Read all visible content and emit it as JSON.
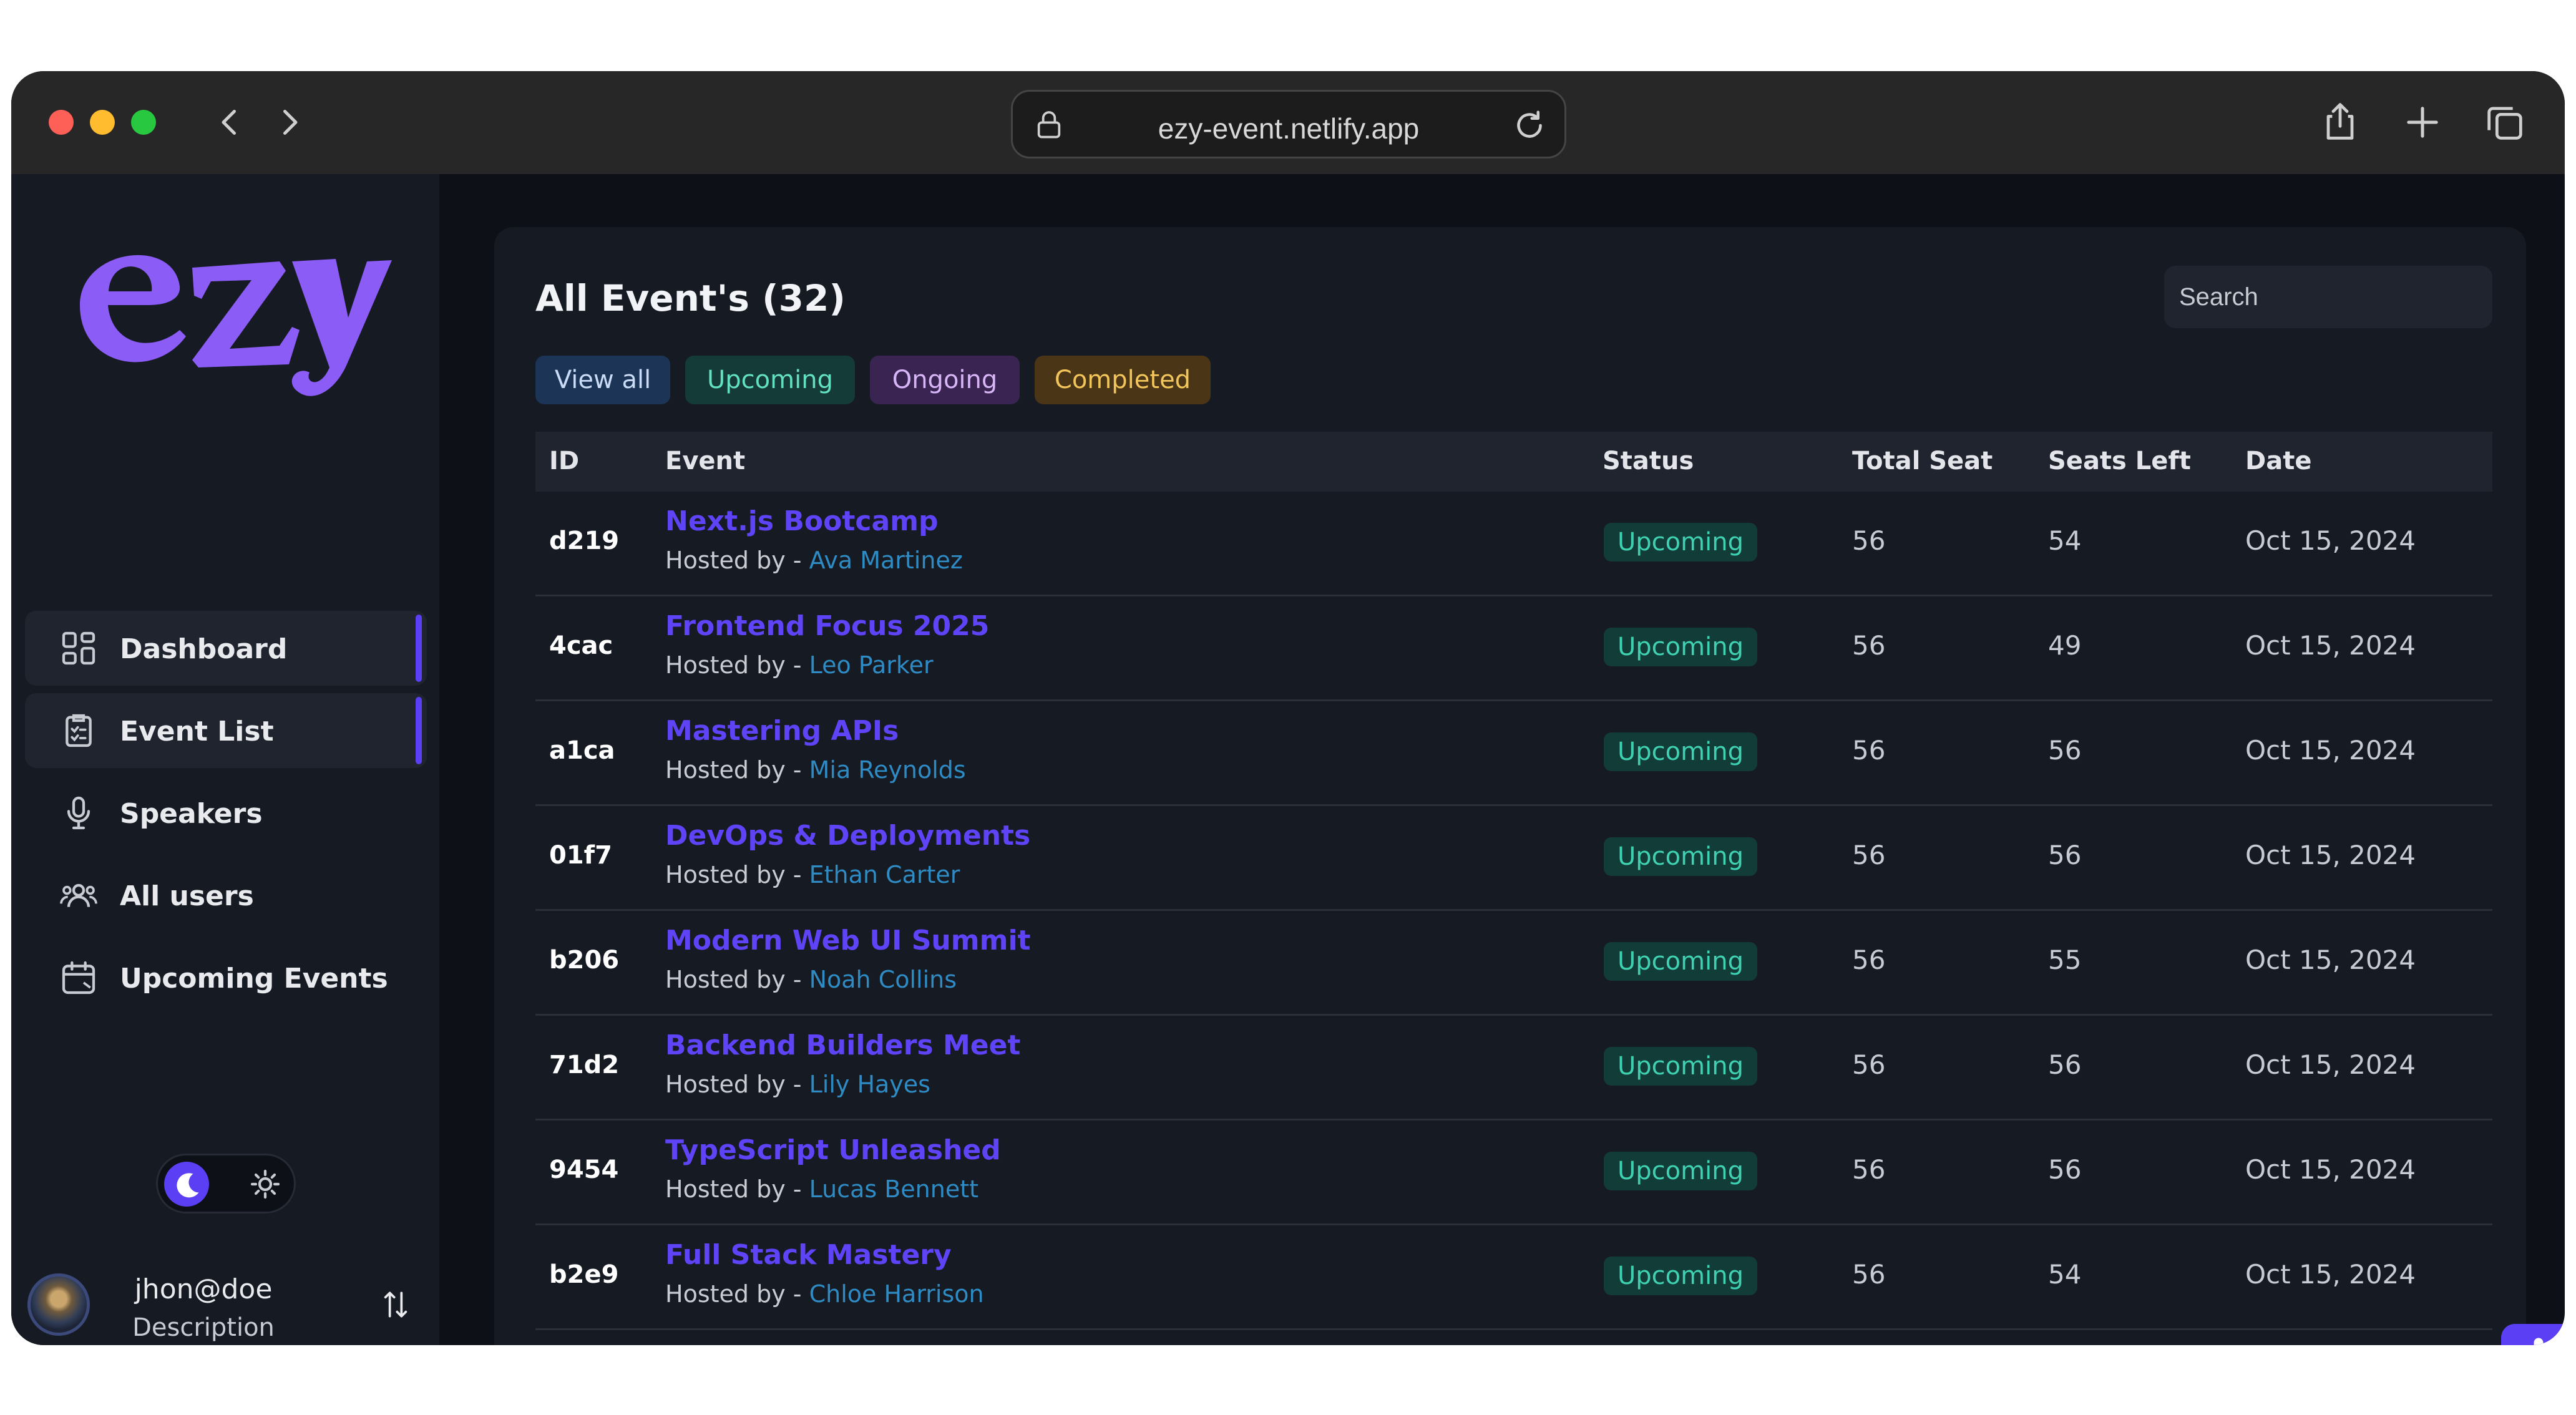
{
  "browser": {
    "url": "ezy-event.netlify.app"
  },
  "sidebar": {
    "logo_text": "ezy",
    "items": [
      {
        "label": "Dashboard",
        "icon": "dashboard-grid-icon",
        "active": true
      },
      {
        "label": "Event List",
        "icon": "checklist-icon",
        "active": true
      },
      {
        "label": "Speakers",
        "icon": "microphone-icon",
        "active": false
      },
      {
        "label": "All users",
        "icon": "users-icon",
        "active": false
      },
      {
        "label": "Upcoming Events",
        "icon": "calendar-icon",
        "active": false
      }
    ],
    "theme": "dark",
    "user": {
      "name": "jhon@doe",
      "description": "Description"
    }
  },
  "main": {
    "title": "All Event's (32)",
    "search_placeholder": "Search",
    "filters": {
      "all": "View all",
      "upcoming": "Upcoming",
      "ongoing": "Ongoing",
      "completed": "Completed"
    },
    "columns": {
      "id": "ID",
      "event": "Event",
      "status": "Status",
      "total": "Total Seat",
      "left": "Seats Left",
      "date": "Date"
    },
    "hosted_prefix": "Hosted by - ",
    "rows": [
      {
        "id": "d219",
        "title": "Next.js Bootcamp",
        "host": "Ava Martinez",
        "status": "Upcoming",
        "total": "56",
        "left": "54",
        "date": "Oct 15, 2024"
      },
      {
        "id": "4cac",
        "title": "Frontend Focus 2025",
        "host": "Leo Parker",
        "status": "Upcoming",
        "total": "56",
        "left": "49",
        "date": "Oct 15, 2024"
      },
      {
        "id": "a1ca",
        "title": "Mastering APIs",
        "host": "Mia Reynolds",
        "status": "Upcoming",
        "total": "56",
        "left": "56",
        "date": "Oct 15, 2024"
      },
      {
        "id": "01f7",
        "title": "DevOps & Deployments",
        "host": "Ethan Carter",
        "status": "Upcoming",
        "total": "56",
        "left": "56",
        "date": "Oct 15, 2024"
      },
      {
        "id": "b206",
        "title": "Modern Web UI Summit",
        "host": "Noah Collins",
        "status": "Upcoming",
        "total": "56",
        "left": "55",
        "date": "Oct 15, 2024"
      },
      {
        "id": "71d2",
        "title": "Backend Builders Meet",
        "host": "Lily Hayes",
        "status": "Upcoming",
        "total": "56",
        "left": "56",
        "date": "Oct 15, 2024"
      },
      {
        "id": "9454",
        "title": "TypeScript Unleashed",
        "host": "Lucas Bennett",
        "status": "Upcoming",
        "total": "56",
        "left": "56",
        "date": "Oct 15, 2024"
      },
      {
        "id": "b2e9",
        "title": "Full Stack Mastery",
        "host": "Chloe Harrison",
        "status": "Upcoming",
        "total": "56",
        "left": "54",
        "date": "Oct 15, 2024"
      }
    ]
  },
  "colors": {
    "accent": "#5b3ff5",
    "logo": "#8b5cf6",
    "status_upcoming": "#3ed1b2",
    "host_name": "#2f8bc4"
  }
}
